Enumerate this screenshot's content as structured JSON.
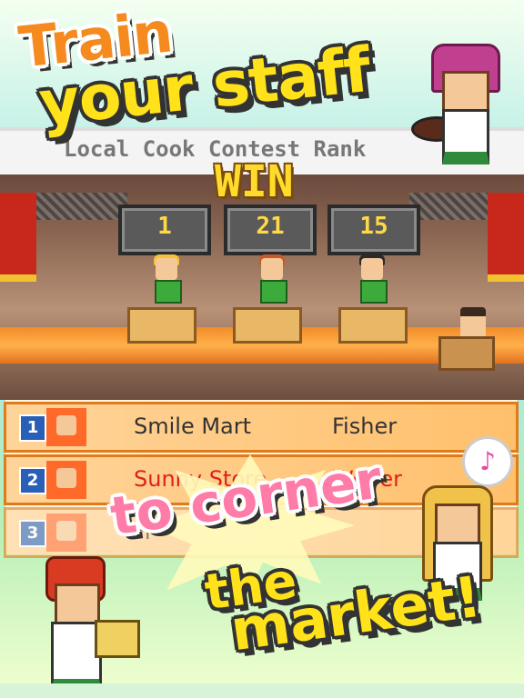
{
  "promo": {
    "line1": "Train",
    "line2": "your staff",
    "line3": "to corner",
    "line4": "the",
    "line5": "market!"
  },
  "contest": {
    "title": "Local Cook Contest  Rank",
    "result_label": "WIN",
    "scores": [
      "1",
      "21",
      "15"
    ]
  },
  "ranking": [
    {
      "rank": "1",
      "store": "Smile Mart",
      "manager": "Fisher"
    },
    {
      "rank": "2",
      "store": "Sunny Store",
      "manager": "Weber"
    },
    {
      "rank": "3",
      "store": "Fr",
      "manager": ""
    }
  ],
  "icons": {
    "note": "♪"
  },
  "colors": {
    "accent_orange": "#f58a1f",
    "accent_yellow": "#ffe21a",
    "accent_pink": "#ff7ba8",
    "highlight_red": "#e0201a"
  }
}
